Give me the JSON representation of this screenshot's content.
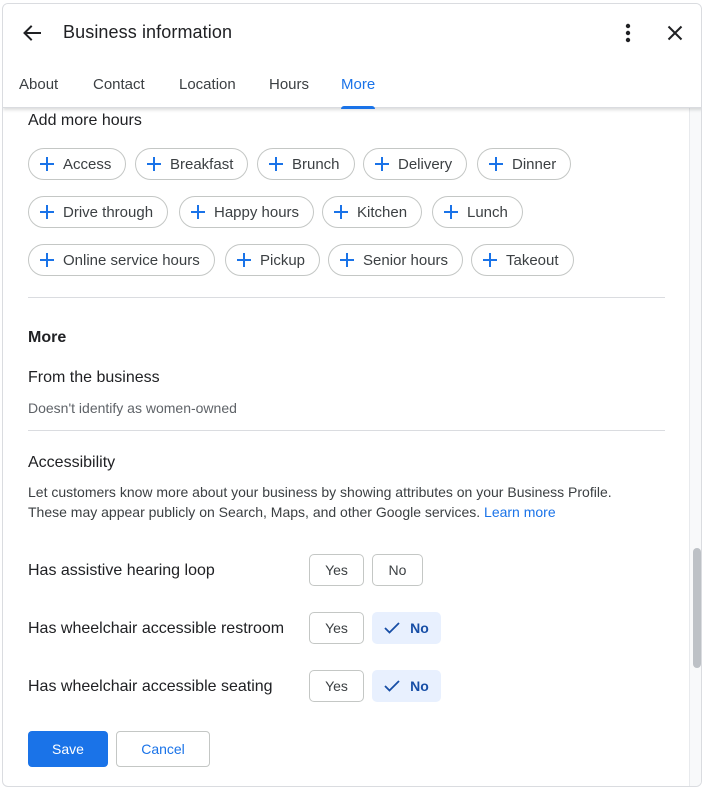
{
  "header": {
    "title": "Business information",
    "back_icon": "arrow-left-icon",
    "menu_icon": "more-vert-icon",
    "close_icon": "close-icon"
  },
  "tabs": [
    {
      "label": "About",
      "active": false
    },
    {
      "label": "Contact",
      "active": false
    },
    {
      "label": "Location",
      "active": false
    },
    {
      "label": "Hours",
      "active": false
    },
    {
      "label": "More",
      "active": true
    }
  ],
  "more_hours": {
    "label": "Add more hours",
    "chips": [
      "Access",
      "Breakfast",
      "Brunch",
      "Delivery",
      "Dinner",
      "Drive through",
      "Happy hours",
      "Kitchen",
      "Lunch",
      "Online service hours",
      "Pickup",
      "Senior hours",
      "Takeout"
    ]
  },
  "more": {
    "heading": "More",
    "from_business": {
      "title": "From the business",
      "value": "Doesn't identify as women-owned"
    },
    "accessibility": {
      "title": "Accessibility",
      "description": "Let customers know more about your business by showing attributes on your Business Profile. These may appear publicly on Search, Maps, and other Google services.",
      "learn_more": "Learn more",
      "attributes": [
        {
          "label": "Has assistive hearing loop",
          "yes": "Yes",
          "no": "No",
          "selected": "none"
        },
        {
          "label": "Has wheelchair accessible restroom",
          "yes": "Yes",
          "no": "No",
          "selected": "no"
        },
        {
          "label": "Has wheelchair accessible seating",
          "yes": "Yes",
          "no": "No",
          "selected": "no"
        }
      ]
    }
  },
  "footer": {
    "save_label": "Save",
    "cancel_label": "Cancel"
  },
  "colors": {
    "accent": "#1a73e8",
    "selected_bg": "#e8f0fe"
  }
}
